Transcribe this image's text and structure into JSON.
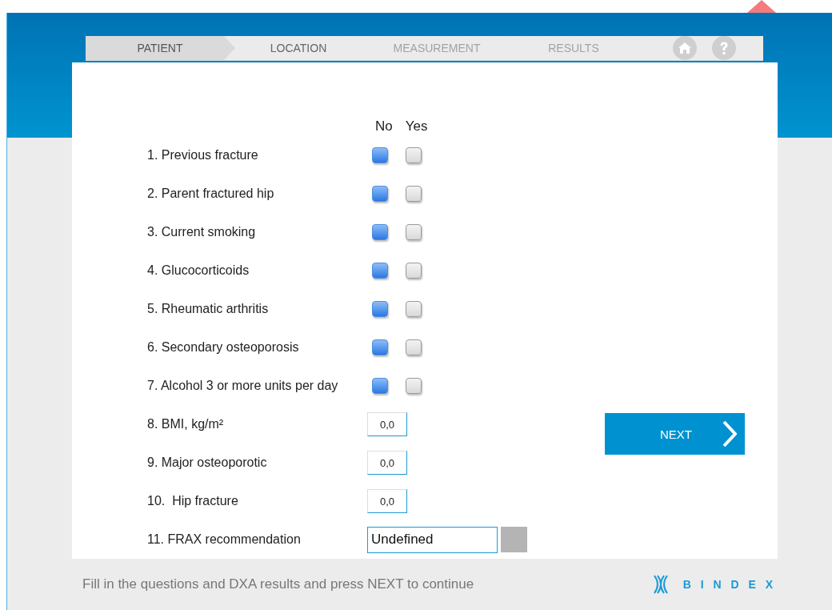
{
  "steps": [
    {
      "label": "PATIENT",
      "selected": true,
      "disabled": false
    },
    {
      "label": "LOCATION",
      "selected": false,
      "disabled": false
    },
    {
      "label": "MEASUREMENT",
      "selected": false,
      "disabled": true
    },
    {
      "label": "RESULTS",
      "selected": false,
      "disabled": true
    }
  ],
  "answer_columns": [
    "No",
    "Yes"
  ],
  "questions": [
    {
      "kind": "yesno",
      "label": "1. Previous fracture",
      "no": true,
      "yes": false
    },
    {
      "kind": "yesno",
      "label": "2. Parent fractured hip",
      "no": true,
      "yes": false
    },
    {
      "kind": "yesno",
      "label": "3. Current smoking",
      "no": true,
      "yes": false
    },
    {
      "kind": "yesno",
      "label": "4. Glucocorticoids",
      "no": true,
      "yes": false
    },
    {
      "kind": "yesno",
      "label": "5. Rheumatic arthritis",
      "no": true,
      "yes": false
    },
    {
      "kind": "yesno",
      "label": "6. Secondary osteoporosis",
      "no": true,
      "yes": false
    },
    {
      "kind": "yesno",
      "label": "7. Alcohol 3 or more units per day",
      "no": true,
      "yes": false
    },
    {
      "kind": "number",
      "label": "8. BMI, kg/m²",
      "value": "0,0"
    },
    {
      "kind": "number",
      "label": "9. Major osteoporotic",
      "value": "0,0"
    },
    {
      "kind": "number",
      "label": "10.  Hip fracture",
      "value": "0,0"
    },
    {
      "kind": "select",
      "label": "11. FRAX recommendation",
      "value": "Undefined"
    }
  ],
  "next_button": "NEXT",
  "footer": {
    "hint": "Fill in the questions and DXA results and press NEXT to continue",
    "logo": "B I N D E X"
  }
}
